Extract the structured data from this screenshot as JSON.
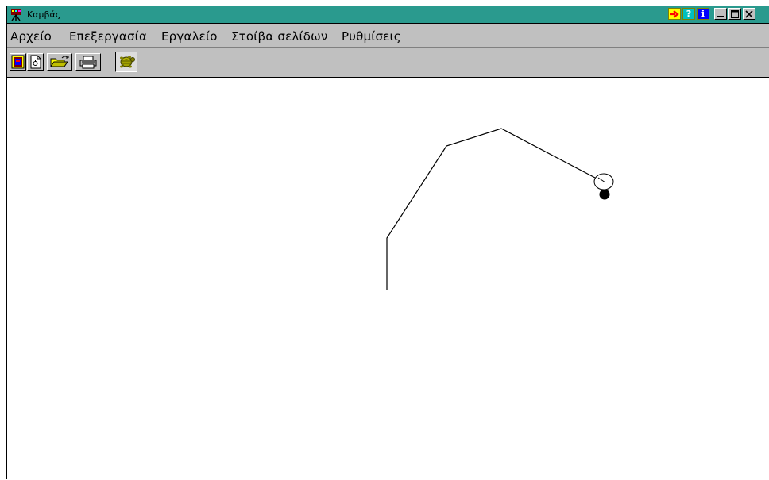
{
  "window": {
    "title": "Καμβάς",
    "app_icon": "turtle-app-icon",
    "title_buttons": [
      {
        "name": "arrow-icon",
        "color": "#ff0000"
      },
      {
        "name": "help-icon",
        "color": "#008080"
      },
      {
        "name": "info-icon",
        "color": "#0000ff"
      },
      {
        "name": "minimize-icon"
      },
      {
        "name": "maximize-icon"
      },
      {
        "name": "close-icon"
      }
    ]
  },
  "menu": {
    "items": [
      {
        "label": "Αρχείο"
      },
      {
        "label": "Επεξεργασία"
      },
      {
        "label": "Εργαλείο"
      },
      {
        "label": "Στοίβα σελίδων"
      },
      {
        "label": "Ρυθμίσεις"
      }
    ]
  },
  "toolbar": {
    "buttons": [
      {
        "name": "new-page-icon"
      },
      {
        "name": "blank-page-icon"
      },
      {
        "name": "open-folder-icon"
      },
      {
        "name": "print-icon"
      },
      {
        "name": "turtle-icon",
        "pressed": true
      }
    ]
  },
  "canvas": {
    "stroke_color": "#000000",
    "turtle_heading": "down"
  },
  "colors": {
    "titlebar": "#2a9a8e",
    "chrome": "#c0c0c0",
    "canvas": "#ffffff"
  }
}
